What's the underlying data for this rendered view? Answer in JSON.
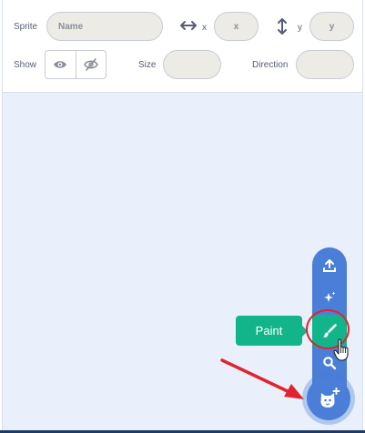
{
  "sprite_info": {
    "sprite_label": "Sprite",
    "name_placeholder": "Name",
    "x_label": "x",
    "x_placeholder": "x",
    "y_label": "y",
    "y_placeholder": "y",
    "show_label": "Show",
    "size_label": "Size",
    "direction_label": "Direction"
  },
  "sprite_menu": {
    "items": [
      "upload-icon",
      "surprise-icon",
      "paint-brush-icon",
      "search-icon"
    ],
    "paint_tooltip": "Paint",
    "main_button_icon": "cat-plus-icon"
  },
  "colors": {
    "menu_blue": "#4b7ed6",
    "paint_green": "#12b58a",
    "annotation_red": "#e0232e",
    "stage_background": "#e9f0fb"
  }
}
